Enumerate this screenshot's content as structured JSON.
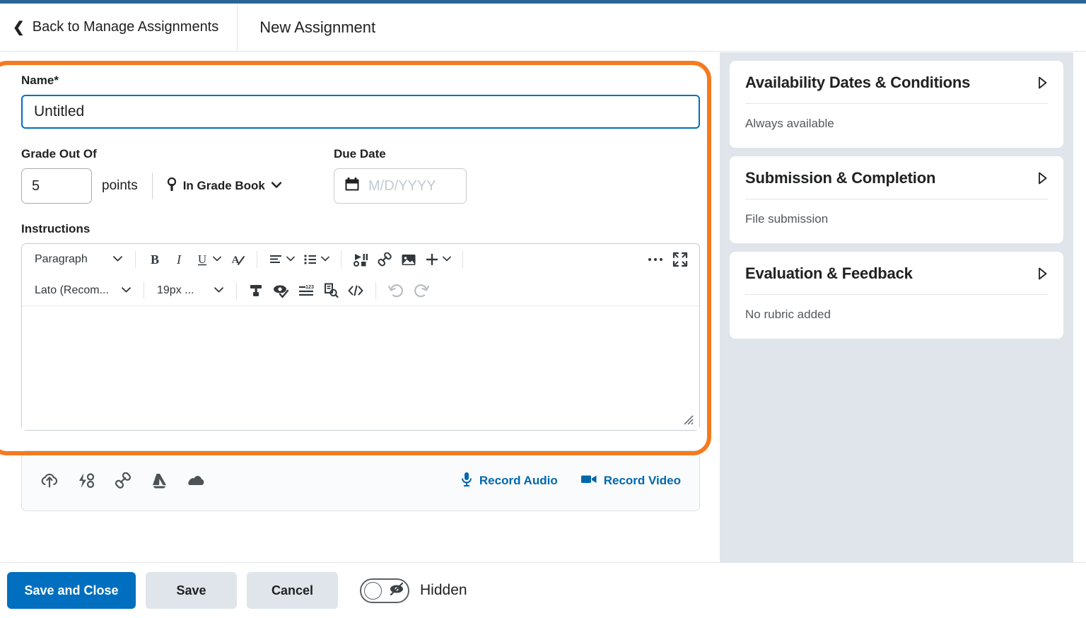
{
  "header": {
    "back_label": "Back to Manage Assignments",
    "back_icon": "chevron-left-icon",
    "page_title": "New Assignment"
  },
  "form": {
    "name_label": "Name",
    "name_required_mark": "*",
    "name_value": "Untitled",
    "grade_label": "Grade Out Of",
    "points_value": "5",
    "points_unit": "points",
    "gradebook_label": "In Grade Book",
    "gradebook_icon": "keyhole-pin-icon",
    "due_label": "Due Date",
    "due_placeholder": "M/D/YYYY",
    "due_icon": "calendar-icon",
    "instructions_label": "Instructions"
  },
  "editor": {
    "row1": [
      {
        "name": "paragraph-style-select",
        "label": "Paragraph",
        "type": "select"
      },
      {
        "name": "bold-button",
        "label": "B",
        "type": "icon"
      },
      {
        "name": "italic-button",
        "label": "I",
        "type": "icon"
      },
      {
        "name": "underline-button",
        "label": "U",
        "type": "icon"
      },
      {
        "name": "clear-formatting-button",
        "label": "A",
        "type": "icon"
      },
      {
        "name": "align-button",
        "label": "align",
        "type": "icon"
      },
      {
        "name": "list-button",
        "label": "list",
        "type": "icon"
      },
      {
        "name": "insert-media-button",
        "label": "media",
        "type": "icon"
      },
      {
        "name": "insert-quicklink-button",
        "label": "link",
        "type": "icon"
      },
      {
        "name": "insert-image-button",
        "label": "image",
        "type": "icon"
      },
      {
        "name": "insert-more-button",
        "label": "+",
        "type": "icon"
      },
      {
        "name": "more-options-button",
        "label": "...",
        "type": "icon"
      },
      {
        "name": "fullscreen-button",
        "label": "fullscreen",
        "type": "icon"
      }
    ],
    "row2": [
      {
        "name": "font-family-select",
        "label": "Lato (Recom...",
        "type": "select"
      },
      {
        "name": "font-size-select",
        "label": "19px ...",
        "type": "select"
      },
      {
        "name": "format-painter-button",
        "label": "painter",
        "type": "icon"
      },
      {
        "name": "accessibility-check-button",
        "label": "a11y",
        "type": "icon"
      },
      {
        "name": "word-count-button",
        "label": "count",
        "type": "icon"
      },
      {
        "name": "preview-button",
        "label": "preview",
        "type": "icon"
      },
      {
        "name": "source-code-button",
        "label": "</>",
        "type": "icon"
      },
      {
        "name": "undo-button",
        "label": "undo",
        "type": "icon"
      },
      {
        "name": "redo-button",
        "label": "redo",
        "type": "icon"
      }
    ],
    "content": ""
  },
  "attachments": {
    "icons": [
      {
        "name": "upload-file-icon",
        "label": "Upload"
      },
      {
        "name": "quicklink-icon",
        "label": "Quicklink"
      },
      {
        "name": "link-icon",
        "label": "Link"
      },
      {
        "name": "google-drive-icon",
        "label": "Google Drive"
      },
      {
        "name": "onedrive-icon",
        "label": "OneDrive"
      }
    ],
    "record_audio_label": "Record Audio",
    "record_video_label": "Record Video"
  },
  "sidebar": {
    "cards": [
      {
        "title": "Availability Dates & Conditions",
        "summary": "Always available"
      },
      {
        "title": "Submission & Completion",
        "summary": "File submission"
      },
      {
        "title": "Evaluation & Feedback",
        "summary": "No rubric added"
      }
    ]
  },
  "footer": {
    "save_and_close_label": "Save and Close",
    "save_label": "Save",
    "cancel_label": "Cancel",
    "visibility_label": "Hidden",
    "visibility_on": false,
    "visibility_icon": "eye-slash-icon"
  },
  "colors": {
    "top_strip": "#2a6496",
    "primary_blue": "#006fbf",
    "link_blue": "#0067ad",
    "annotation_orange": "#f47b20",
    "sidebar_bg": "#dfe5eb"
  }
}
